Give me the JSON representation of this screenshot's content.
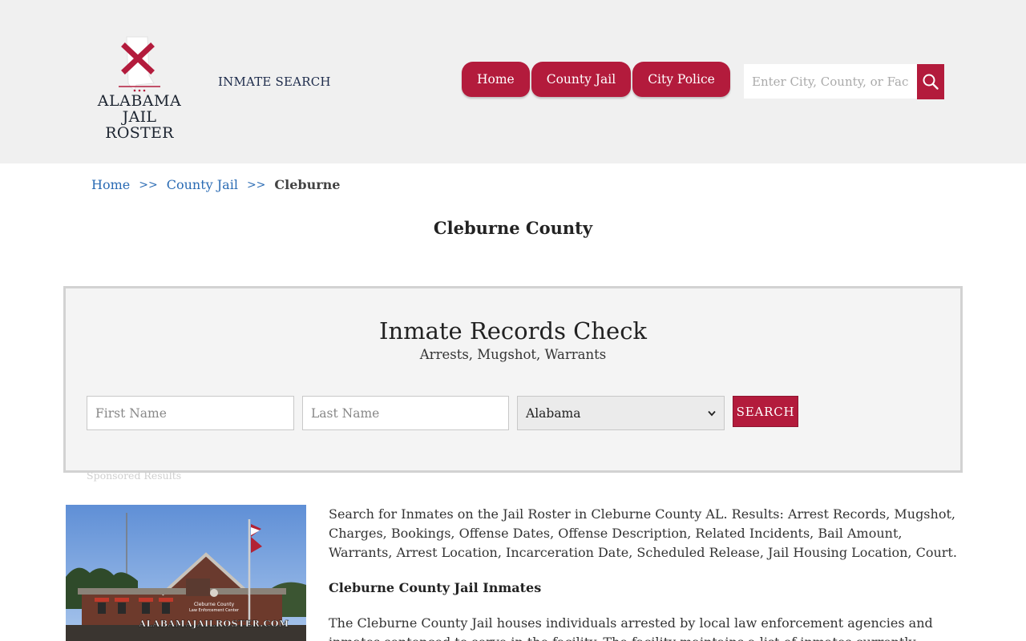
{
  "header": {
    "logo_line1": "ALABAMA",
    "logo_line2": "JAIL ROSTER",
    "inmate_search": "INMATE SEARCH",
    "nav": [
      "Home",
      "County Jail",
      "City Police"
    ],
    "search_placeholder": "Enter City, County, or Facility"
  },
  "breadcrumb": {
    "home": "Home",
    "sep1": ">>",
    "county_jail": "County Jail",
    "sep2": ">>",
    "current": "Cleburne"
  },
  "page_title": "Cleburne County",
  "records": {
    "title": "Inmate Records Check",
    "subtitle": "Arrests, Mugshot, Warrants",
    "first_name_placeholder": "First Name",
    "last_name_placeholder": "Last Name",
    "state_selected": "Alabama",
    "search_label": "SEARCH"
  },
  "sponsored": "Sponsored Results",
  "photo": {
    "sign_line1": "Cleburne County",
    "sign_line2": "Law Enforcement Center",
    "watermark": "ALABAMAJAILROSTER.COM"
  },
  "content": {
    "intro": "Search for Inmates on the Jail Roster in Cleburne County AL. Results: Arrest Records, Mugshot, Charges, Bookings, Offense Dates, Offense Description, Related Incidents, Bail Amount, Warrants, Arrest Location, Incarceration Date, Scheduled Release, Jail Housing Location, Court.",
    "heading": "Cleburne County Jail Inmates",
    "body": "The Cleburne County Jail houses individuals arrested by local law enforcement agencies and inmates sentenced to serve in the facility. The facility maintains a list of inmates currently housed within. Each"
  },
  "colors": {
    "accent": "#b31b3c",
    "link": "#2a6bb4",
    "header_bg": "#f0f0f0"
  }
}
